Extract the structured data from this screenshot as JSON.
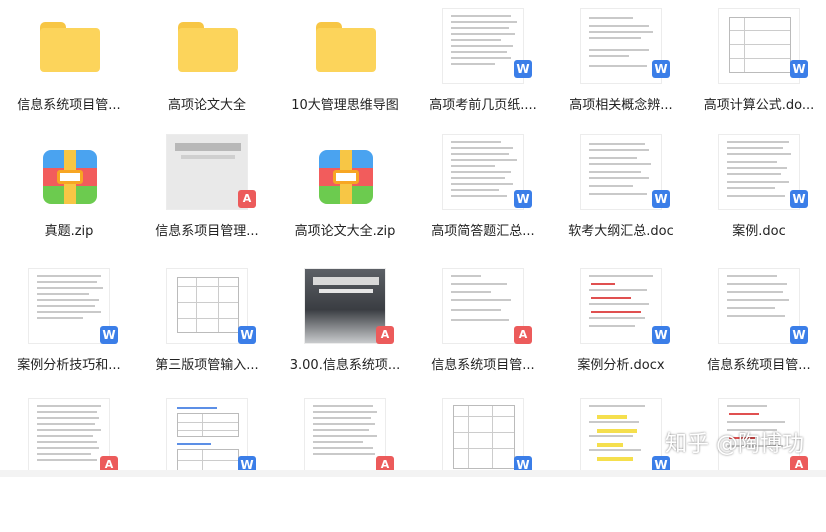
{
  "files": [
    {
      "name": "信息系统项目管...",
      "type": "folder"
    },
    {
      "name": "高项论文大全",
      "type": "folder"
    },
    {
      "name": "10大管理思维导图",
      "type": "folder"
    },
    {
      "name": "高项考前几页纸....",
      "type": "word"
    },
    {
      "name": "高项相关概念辨...",
      "type": "word"
    },
    {
      "name": "高项计算公式.do...",
      "type": "word"
    },
    {
      "name": "真题.zip",
      "type": "zip"
    },
    {
      "name": "信息系项目管理...",
      "type": "pdf"
    },
    {
      "name": "高项论文大全.zip",
      "type": "zip"
    },
    {
      "name": "高项简答题汇总...",
      "type": "word"
    },
    {
      "name": "软考大纲汇总.doc",
      "type": "word"
    },
    {
      "name": "案例.doc",
      "type": "word"
    },
    {
      "name": "案例分析技巧和...",
      "type": "word"
    },
    {
      "name": "第三版项管输入...",
      "type": "word"
    },
    {
      "name": "3.00.信息系统项...",
      "type": "pdf"
    },
    {
      "name": "信息系统项目管...",
      "type": "pdf"
    },
    {
      "name": "案例分析.docx",
      "type": "word"
    },
    {
      "name": "信息系统项目管...",
      "type": "word"
    },
    {
      "name": "",
      "type": "pdf"
    },
    {
      "name": "",
      "type": "word"
    },
    {
      "name": "",
      "type": "pdf"
    },
    {
      "name": "",
      "type": "word"
    },
    {
      "name": "",
      "type": "word"
    },
    {
      "name": "",
      "type": "pdf"
    }
  ],
  "badges": {
    "word": "W",
    "pdf": "A"
  },
  "watermark": "知乎 @陶博功",
  "colors": {
    "folder": "#fcd45b",
    "word_badge": "#3b7ee8",
    "pdf_badge": "#ec5b5b"
  }
}
